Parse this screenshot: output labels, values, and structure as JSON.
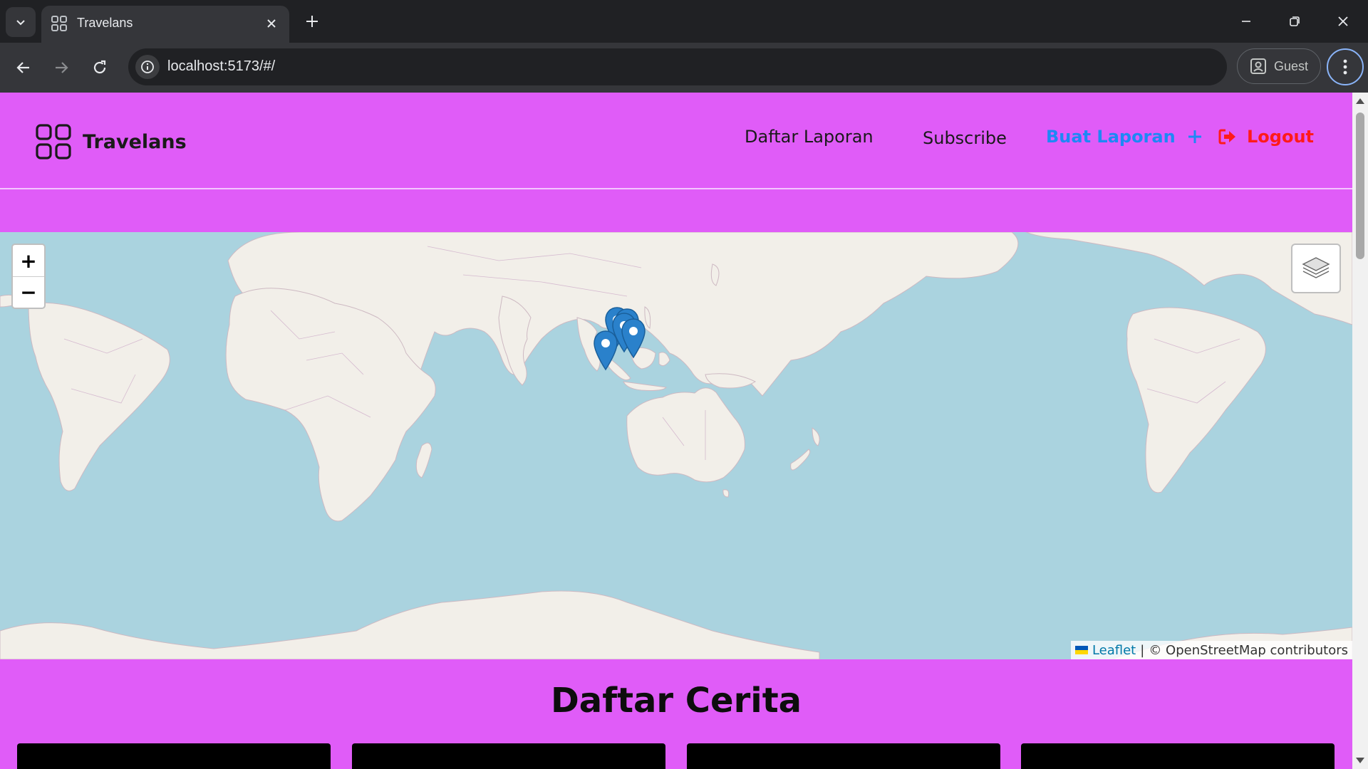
{
  "browser": {
    "tab_title": "Travelans",
    "url": "localhost:5173/#/",
    "profile_label": "Guest"
  },
  "header": {
    "brand": "Travelans",
    "nav": {
      "list": "Daftar Laporan",
      "subscribe": "Subscribe",
      "create": "Buat Laporan",
      "logout": "Logout"
    }
  },
  "map": {
    "zoom_in": "+",
    "zoom_out": "−",
    "attribution": {
      "leaflet": "Leaflet",
      "separator": "|",
      "osm": "© OpenStreetMap contributors"
    },
    "marker_count": 5
  },
  "stories": {
    "title": "Daftar Cerita",
    "card_count": 4
  },
  "colors": {
    "page_bg": "#e05cf8",
    "ocean": "#aad3df",
    "land": "#f2efe9",
    "marker": "#2a81cb",
    "create_link": "#1e88f5",
    "logout_link": "#ff1a1a"
  }
}
